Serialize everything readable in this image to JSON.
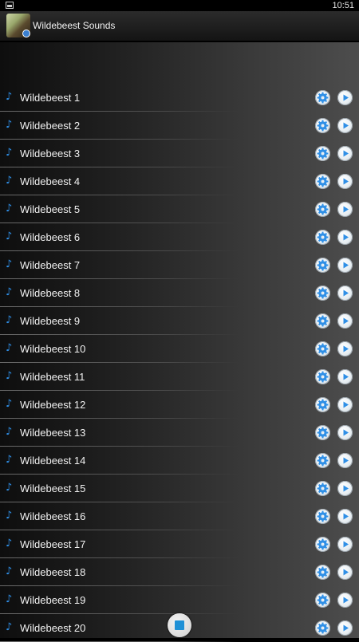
{
  "status_bar": {
    "time": "10:51",
    "notification_icon": "image-notification-icon"
  },
  "action_bar": {
    "title": "Wildebeest Sounds",
    "app_icon": "wildebeest-app-icon"
  },
  "list": {
    "item_icon": "music-note-icon",
    "settings_icon": "gear-icon",
    "play_icon": "play-icon",
    "items": [
      {
        "label": "Wildebeest 1"
      },
      {
        "label": "Wildebeest 2"
      },
      {
        "label": "Wildebeest 3"
      },
      {
        "label": "Wildebeest 4"
      },
      {
        "label": "Wildebeest 5"
      },
      {
        "label": "Wildebeest 6"
      },
      {
        "label": "Wildebeest 7"
      },
      {
        "label": "Wildebeest 8"
      },
      {
        "label": "Wildebeest 9"
      },
      {
        "label": "Wildebeest 10"
      },
      {
        "label": "Wildebeest 11"
      },
      {
        "label": "Wildebeest 12"
      },
      {
        "label": "Wildebeest 13"
      },
      {
        "label": "Wildebeest 14"
      },
      {
        "label": "Wildebeest 15"
      },
      {
        "label": "Wildebeest 16"
      },
      {
        "label": "Wildebeest 17"
      },
      {
        "label": "Wildebeest 18"
      },
      {
        "label": "Wildebeest 19"
      },
      {
        "label": "Wildebeest 20"
      }
    ]
  },
  "floating_button": {
    "icon": "stop-icon"
  },
  "colors": {
    "accent": "#2f8fe6",
    "text": "#f2f2f2",
    "background_dark": "#0e0e0e"
  }
}
